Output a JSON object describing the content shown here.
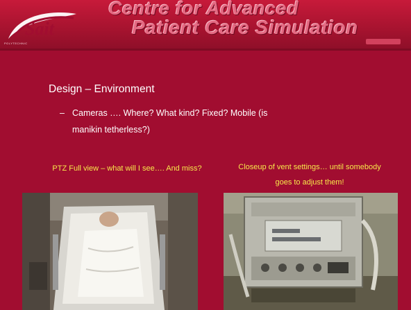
{
  "banner": {
    "logo_text": "Sait",
    "logo_subtext": "POLYTECHNIC",
    "line1": "Centre for Advanced",
    "line2": "Patient Care Simulation"
  },
  "slide": {
    "title": "Design – Environment",
    "bullet_marker": "–",
    "bullet_text": "Cameras …. Where?  What kind?  Fixed? Mobile (is manikin tetherless?)"
  },
  "images": {
    "left_caption": "PTZ Full view – what will I see…. And miss?",
    "right_caption": "Closeup of vent settings… until somebody goes to adjust them!",
    "left_icon": "patient-bed-photo",
    "right_icon": "ventilator-photo"
  },
  "colors": {
    "background": "#a10d30",
    "caption": "#f7e84a",
    "text": "#ffffff"
  }
}
